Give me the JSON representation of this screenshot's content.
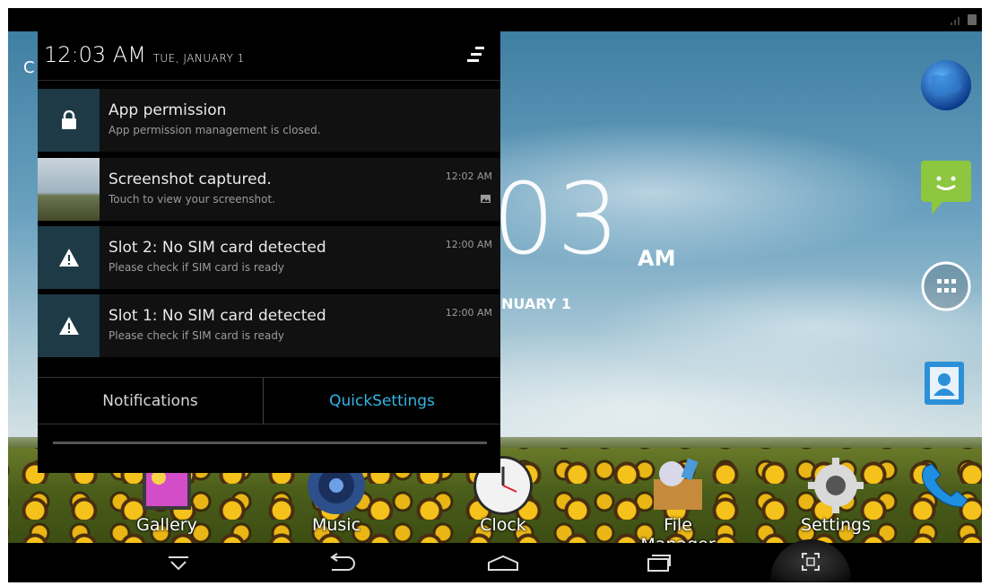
{
  "statusbar": {
    "icons": [
      "signal-icon",
      "sim-icon"
    ]
  },
  "lockscreen": {
    "clock_left": "C",
    "clock_big": "03",
    "ampm": "AM",
    "date": "NUARY 1"
  },
  "shade": {
    "time": "12:03 AM",
    "date": "TUE, JANUARY 1",
    "notifications": [
      {
        "title": "App permission",
        "subtitle": "App permission management is closed.",
        "time": "",
        "icon": "lock-icon"
      },
      {
        "title": "Screenshot captured.",
        "subtitle": "Touch to view your screenshot.",
        "time": "12:02 AM",
        "icon": "screenshot-thumbnail"
      },
      {
        "title": "Slot 2: No SIM card detected",
        "subtitle": "Please check if SIM card is ready",
        "time": "12:00 AM",
        "icon": "warning-icon"
      },
      {
        "title": "Slot 1: No SIM card detected",
        "subtitle": "Please check if SIM card is ready",
        "time": "12:00 AM",
        "icon": "warning-icon"
      }
    ],
    "tabs": {
      "notifications": "Notifications",
      "quicksettings": "QuickSettings"
    },
    "colors": {
      "accent": "#33b5e5",
      "icon_bg": "#1e3a46"
    }
  },
  "home": {
    "apps": [
      {
        "label": "Gallery"
      },
      {
        "label": "Music"
      },
      {
        "label": "Clock"
      },
      {
        "label": "File Manager"
      },
      {
        "label": "Settings"
      }
    ]
  },
  "navbar": {
    "icons": [
      "hide-keyboard-icon",
      "back-icon",
      "home-icon",
      "recents-icon",
      "screenshot-icon"
    ]
  }
}
